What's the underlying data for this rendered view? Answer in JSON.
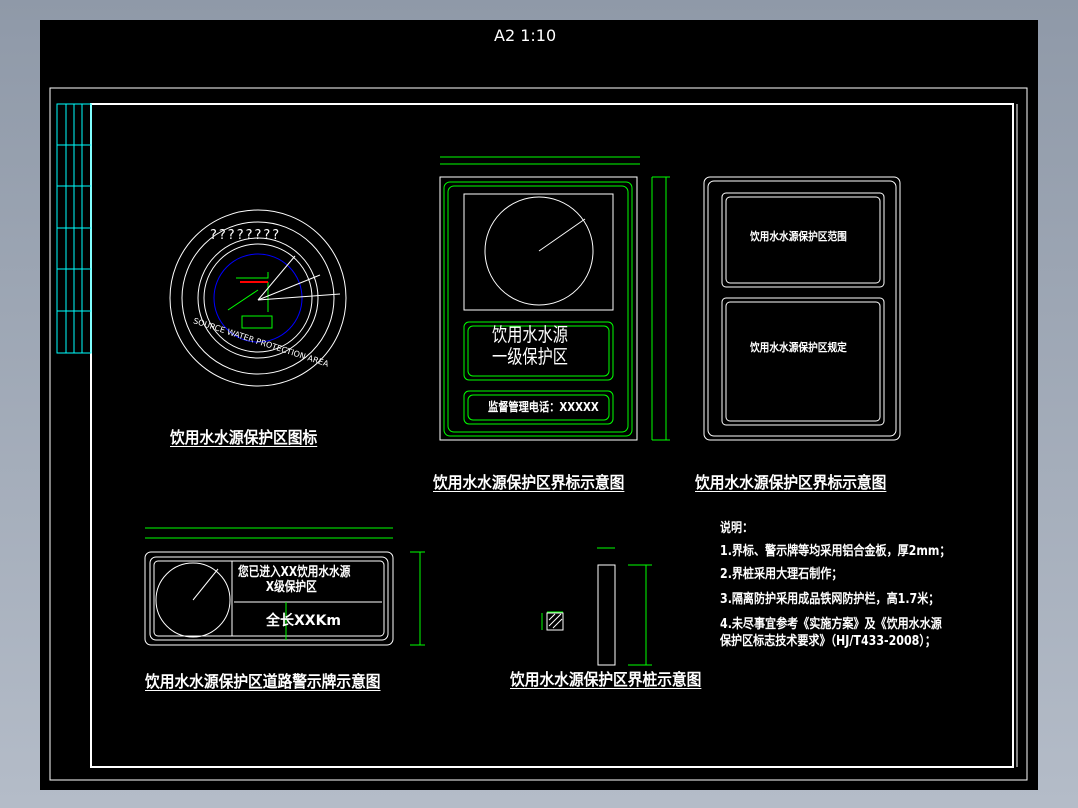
{
  "title": "A2 1:10",
  "emblem": {
    "top_text": "????????",
    "bottom_text": "SOURCE WATER PROTECTION AREA",
    "caption": "饮用水水源保护区图标"
  },
  "boundary_sign": {
    "main_text_line1": "饮用水水源",
    "main_text_line2": "一级保护区",
    "phone_text": "监督管理电话：XXXXX",
    "caption": "饮用水水源保护区界标示意图"
  },
  "info_sign": {
    "box1_text": "饮用水水源保护区范围",
    "box2_text": "饮用水水源保护区规定",
    "caption": "饮用水水源保护区界标示意图"
  },
  "road_sign": {
    "line1": "您已进入XX饮用水水源",
    "line2": "X级保护区",
    "length_text": "全长XXKm",
    "caption": "饮用水水源保护区道路警示牌示意图"
  },
  "pile": {
    "caption": "饮用水水源保护区界桩示意图"
  },
  "notes": {
    "heading": "说明：",
    "items": [
      "1.界标、警示牌等均采用铝合金板，厚2mm；",
      "2.界桩采用大理石制作；",
      "3.隔离防护采用成品铁网防护栏，高1.7米；",
      "4.未尽事宜参考《实施方案》及《饮用水水源",
      "保护区标志技术要求》（HJ/T433-2008）；"
    ]
  },
  "colors": {
    "line": "#ffffff",
    "dim": "#00ff00",
    "titleblock": "#00ffff",
    "emblem_blue": "#0000ff",
    "emblem_red": "#ff0000"
  }
}
